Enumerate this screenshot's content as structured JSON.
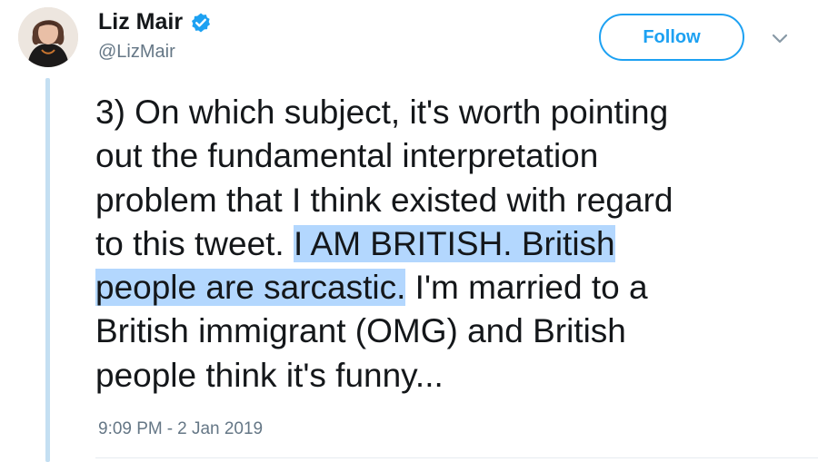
{
  "author": {
    "display_name": "Liz Mair",
    "handle": "@LizMair",
    "verified": true,
    "avatar_icon": "profile-photo"
  },
  "follow_button": {
    "label": "Follow"
  },
  "menu": {
    "icon": "chevron-down-icon"
  },
  "tweet": {
    "lines": [
      {
        "parts": [
          {
            "text": "3) On which subject, it's worth pointing",
            "highlighted": false
          }
        ]
      },
      {
        "parts": [
          {
            "text": "out the fundamental interpretation",
            "highlighted": false
          }
        ]
      },
      {
        "parts": [
          {
            "text": "problem that I think existed with regard",
            "highlighted": false
          }
        ]
      },
      {
        "parts": [
          {
            "text": "to this tweet. ",
            "highlighted": false
          },
          {
            "text": "I AM BRITISH. British",
            "highlighted": true
          }
        ]
      },
      {
        "parts": [
          {
            "text": "people are sarcastic.",
            "highlighted": true
          },
          {
            "text": " I'm married to a",
            "highlighted": false
          }
        ]
      },
      {
        "parts": [
          {
            "text": "British immigrant (OMG) and British",
            "highlighted": false
          }
        ]
      },
      {
        "parts": [
          {
            "text": "people think it's funny...",
            "highlighted": false
          }
        ]
      }
    ]
  },
  "meta": {
    "time": "9:09 PM",
    "separator": "-",
    "date": "2 Jan 2019"
  },
  "colors": {
    "accent": "#1da1f2",
    "highlight": "#b3d7fe",
    "thread_line": "#c4dff2",
    "muted_text": "#657786"
  }
}
